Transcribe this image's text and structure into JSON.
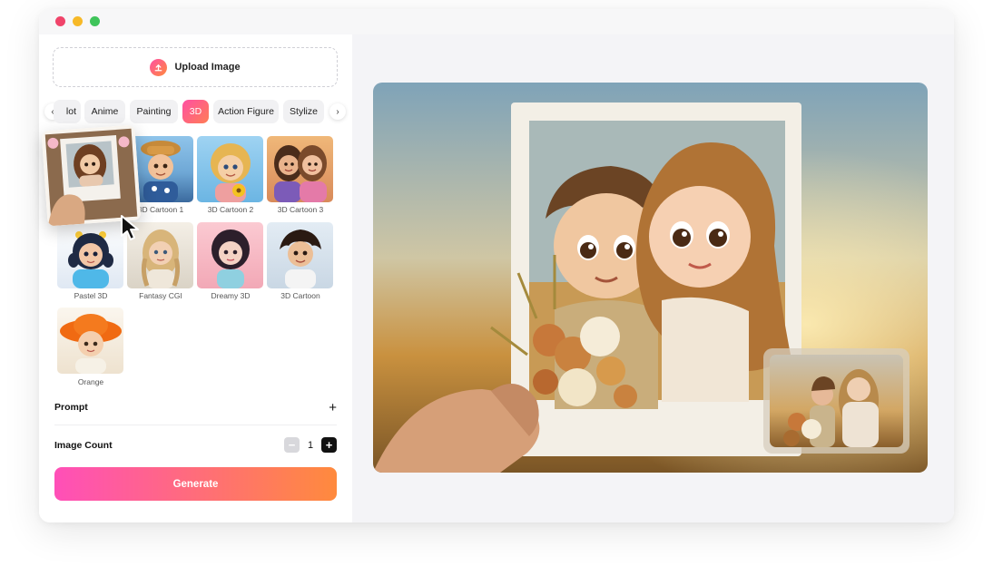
{
  "upload": {
    "label": "Upload Image"
  },
  "tabs": [
    {
      "label": "lot",
      "active": false
    },
    {
      "label": "Anime",
      "active": false
    },
    {
      "label": "Painting",
      "active": false
    },
    {
      "label": "3D",
      "active": true
    },
    {
      "label": "Action Figure",
      "active": false
    },
    {
      "label": "Stylize",
      "active": false
    }
  ],
  "styles": [
    {
      "label": "3D Cartoon 1"
    },
    {
      "label": "3D Cartoon 2"
    },
    {
      "label": "3D Cartoon 3"
    },
    {
      "label": "Pastel 3D"
    },
    {
      "label": "Fantasy CGI"
    },
    {
      "label": "Dreamy 3D"
    },
    {
      "label": "3D Cartoon"
    },
    {
      "label": "Orange"
    }
  ],
  "prompt": {
    "label": "Prompt",
    "toggle": "+"
  },
  "image_count": {
    "label": "Image Count",
    "value": "1",
    "minus": "−",
    "plus": "+"
  },
  "generate": {
    "label": "Generate"
  },
  "colors": {
    "accent_start": "#ff4fb8",
    "accent_end": "#ff8a3d"
  }
}
